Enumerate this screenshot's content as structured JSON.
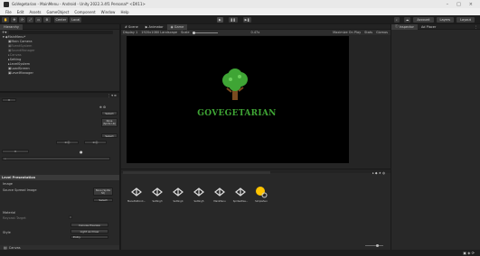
{
  "window": {
    "title": "GoVegetarian - MainMenu - Android - Unity 2022.3.4f1 Personal* <DX11>",
    "controls": [
      "–",
      "□",
      "×"
    ]
  },
  "menu": [
    "File",
    "Edit",
    "Assets",
    "GameObject",
    "Component",
    "Window",
    "Help"
  ],
  "toolbar": {
    "tools": [
      "✋",
      "✥",
      "⟳",
      "⤢",
      "▭",
      "⚙"
    ],
    "center_toggle": "Center",
    "global_toggle": "Local",
    "play_controls": [
      "▶",
      "❚❚",
      "▶❚"
    ],
    "account": "Account",
    "layers": "Layers",
    "layout": "Layout"
  },
  "hierarchy": {
    "tab": "Hierarchy",
    "items": [
      {
        "label": "MainMenu*",
        "indent": 1
      },
      {
        "label": "Main Camera",
        "indent": 2
      },
      {
        "label": "EventSystem",
        "indent": 2
      },
      {
        "label": "SoundManager",
        "indent": 2
      },
      {
        "label": "Canvas",
        "indent": 2
      },
      {
        "label": "Setting",
        "indent": 2
      },
      {
        "label": "LevelSystem",
        "indent": 2
      },
      {
        "label": "LoadScreen",
        "indent": 2
      },
      {
        "label": "LevelManager",
        "indent": 2
      }
    ]
  },
  "views": {
    "tabs": [
      "Scene",
      "Animator",
      "Game"
    ],
    "game_sub": {
      "display": "Display 1",
      "resolution": "1920x1080 Landscape",
      "scale_label": "Scale",
      "scale_value": "0.47x",
      "play_mode": "Maximize On Play",
      "stats": "Stats",
      "gizmos": "Gizmos"
    },
    "game_title": "GOVEGETARIAN"
  },
  "inspector": {
    "tabs": [
      "Inspector",
      "Ad Placer"
    ]
  },
  "left_lower": {
    "header_fields": [
      "Select",
      "None (Sprite Lib)",
      "Select"
    ],
    "section_label": "Level Presentation",
    "image_label": "Image",
    "source_image_label": "Source Spread Image",
    "source_value": "None (Sprite Sil)",
    "select_label": "Select",
    "material_label": "Material",
    "raycast_label": "Raycast Target",
    "style_label": "Style",
    "dropdowns": [
      "Canvas Preview",
      "Light as Draw",
      "Entry"
    ],
    "bottom_label": "Canvas"
  },
  "project": {
    "assets": [
      "MenuButtonC...",
      "Setting3",
      "Setting4",
      "Setting5",
      "MainMenu",
      "SpriteAtlas...",
      "SimpleSun"
    ],
    "slider_label": "15"
  },
  "colors": {
    "logo_green": "#3fa535",
    "tree_trunk": "#7a4a1f",
    "sun_yellow": "#ffc400"
  }
}
